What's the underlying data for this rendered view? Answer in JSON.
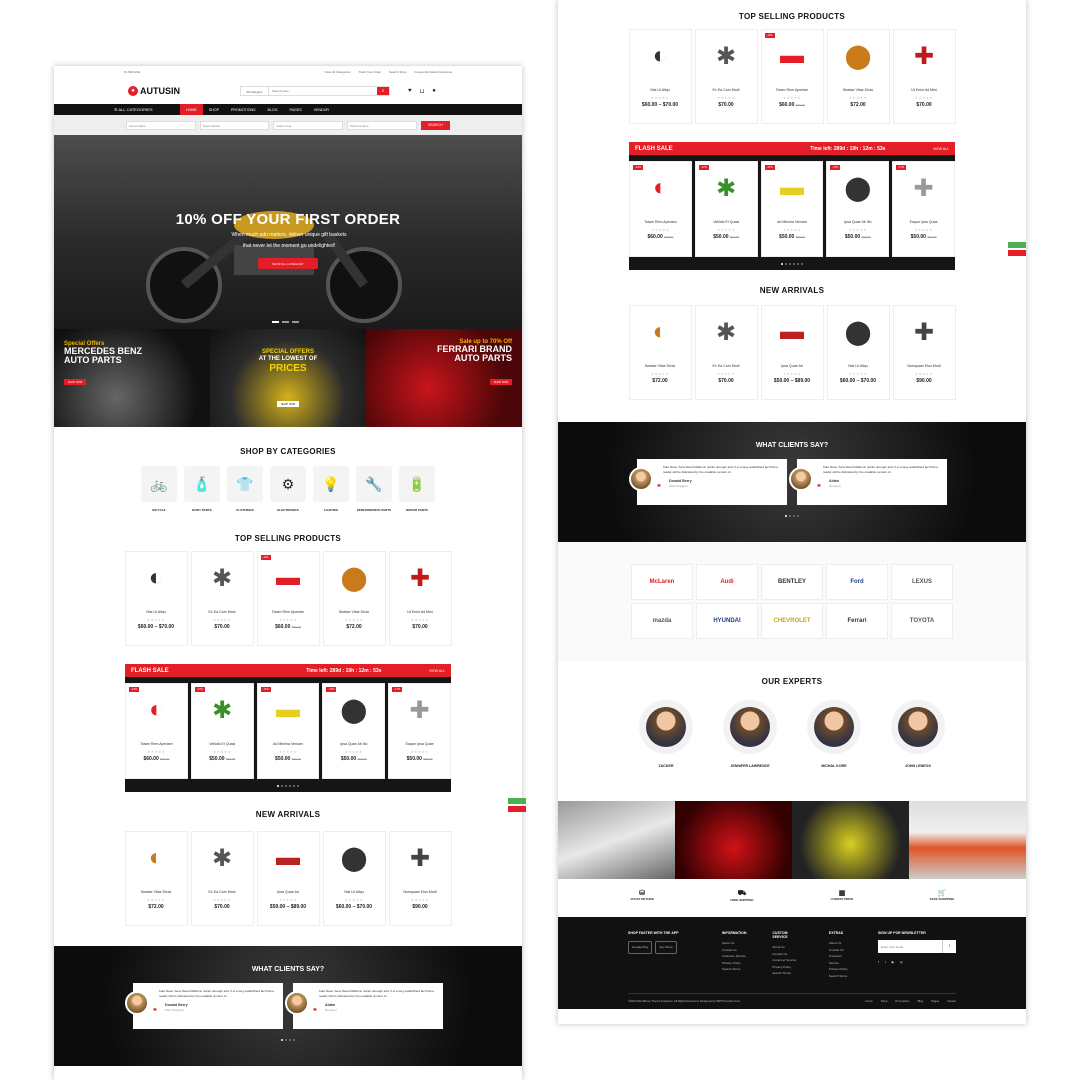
{
  "topbar": {
    "left": "$ USD   ENG",
    "links": [
      "View All Categories",
      "Track Your Order",
      "Search Shop",
      "Frequently Asked Questions"
    ]
  },
  "header": {
    "logo": "AUTUSIN",
    "search_category": "All Category",
    "search_placeholder": "Search Here..."
  },
  "nav": {
    "all_categories": "ALL CATEGORIES",
    "items": [
      "HOME",
      "SHOP",
      "PROMOTIONS",
      "BLOG",
      "PAGES",
      "VENDOR"
    ]
  },
  "filters": {
    "fields": [
      "Select Make",
      "Select Model",
      "Select Year",
      "Select Engine"
    ],
    "button": "SEARCH"
  },
  "hero": {
    "title": "10% OFF YOUR FIRST ORDER",
    "line1": "When much ado matters, deliver unique gift baskets",
    "line2": "that never let the moment go undelighted!",
    "cta": "SHOP ALL CATEGORY"
  },
  "banners": [
    {
      "small": "Special Offers",
      "large1": "MERCEDES BENZ",
      "large2": "AUTO PARTS",
      "button": "SHOP NOW"
    },
    {
      "small": "SPECIAL OFFERS",
      "large1": "AT THE LOWEST OF",
      "large2": "PRICES",
      "button": "SHOP NOW"
    },
    {
      "small": "Sale up to 70% Off",
      "large1": "FERRARI BRAND",
      "large2": "AUTO PARTS",
      "button": "SHOP NOW"
    }
  ],
  "categories": {
    "title": "SHOP BY CATEGORIES",
    "items": [
      "BICYCLE",
      "BODY PARTS",
      "CLOTHINGS",
      "ELECTRONICS",
      "LIGHTING",
      "PERFORMANCE PARTS",
      "REPAIR PARTS"
    ]
  },
  "top_selling": {
    "title": "TOP SELLING PRODUCTS",
    "items": [
      {
        "name": "Nisi Ut Aliqu",
        "price": "$60.00 – $70.00",
        "old": "",
        "tag": ""
      },
      {
        "name": "Ex Ea Com Modi",
        "price": "$70.00",
        "old": "",
        "tag": ""
      },
      {
        "name": "Totam Rem Aperiam",
        "price": "$60.00",
        "old": "$70.00",
        "tag": "-14%"
      },
      {
        "name": "Beatae Vitae Dicta",
        "price": "$72.00",
        "old": "",
        "tag": ""
      },
      {
        "name": "Ut Enim Ad Mini",
        "price": "$70.00",
        "old": "",
        "tag": ""
      }
    ]
  },
  "flash": {
    "title": "FLASH SALE",
    "timer_label": "Time left:",
    "timer": "289d : 19h : 12m : 53s",
    "view_all": "VIEW ALL",
    "items": [
      {
        "name": "Totam Rem Aperiam",
        "price": "$60.00",
        "old": "$70.00",
        "tag": "-14%"
      },
      {
        "name": "Vellidis Et Quasi",
        "price": "$50.00",
        "old": "$60.00",
        "tag": "-17%"
      },
      {
        "name": "Ad Minima Veniam",
        "price": "$50.00",
        "old": "$60.00",
        "tag": "-17%"
      },
      {
        "name": "Ipsa Quae Ab Illo",
        "price": "$50.00",
        "old": "$60.00",
        "tag": "-17%"
      },
      {
        "name": "Eaque Ipsa Quae",
        "price": "$50.00",
        "old": "$60.00",
        "tag": "-17%"
      }
    ]
  },
  "new_arrivals": {
    "title": "NEW ARRIVALS",
    "items": [
      {
        "name": "Beatae Vitae Dicta",
        "price": "$72.00",
        "old": "",
        "tag": ""
      },
      {
        "name": "Ex Ea Com Modi",
        "price": "$70.00",
        "old": "",
        "tag": ""
      },
      {
        "name": "Ipsa Quae Ab",
        "price": "$50.00 – $89.00",
        "old": "",
        "tag": ""
      },
      {
        "name": "Nisi Ut Aliqu",
        "price": "$60.00 – $70.00",
        "old": "",
        "tag": ""
      },
      {
        "name": "Numquam Eius Modi",
        "price": "$90.00",
        "old": "",
        "tag": ""
      }
    ]
  },
  "testimonials": {
    "title": "WHAT CLIENTS SAY?",
    "items": [
      {
        "text": "Kale Rosa, Sora Stuart Mathenn ducks. Enough told. It is a long established fact that a reader will be distracted by the readable content of...",
        "name": "Donald Berry",
        "role": "Web Designer"
      },
      {
        "text": "Kale Rosa, Sora Stuart Mathenn ducks. Enough told. It is a long established fact that a reader will be distracted by the readable content of...",
        "name": "Aidan",
        "role": "Designer"
      }
    ]
  },
  "brands": [
    "McLaren",
    "Audi",
    "BENTLEY",
    "Ford",
    "LEXUS",
    "mazda",
    "HYUNDAI",
    "CHEVROLET",
    "Ferrari",
    "TOYOTA"
  ],
  "experts": {
    "title": "OUR EXPERTS",
    "names": [
      "ZACKER",
      "JENNIFER LAWRENCE",
      "MICHAL KORE",
      "JOHN LENEOS"
    ]
  },
  "features": [
    {
      "label": "15 DAY RETURN",
      "icon": "money-bag-icon"
    },
    {
      "label": "FREE SHIPPING",
      "icon": "truck-icon"
    },
    {
      "label": "LOWEST PRICE",
      "icon": "calendar-icon"
    },
    {
      "label": "SAFE SHOPPING",
      "icon": "cart-icon"
    }
  ],
  "footer": {
    "app_title": "SHOP FASTER WITH THE APP",
    "apps": [
      "Google Play",
      "App Store"
    ],
    "cols": [
      {
        "title": "INFORMATION",
        "links": [
          "About Us",
          "Contact Us",
          "Customer Service",
          "Privacy Policy",
          "Search Terms"
        ]
      },
      {
        "title": "CUSTOM SERVICE",
        "links": [
          "About Us",
          "Contact Us",
          "Customer Service",
          "Privacy Policy",
          "Search Terms"
        ]
      },
      {
        "title": "EXTRAS",
        "links": [
          "About Us",
          "Contact Us",
          "Customer Service",
          "Privacy Policy",
          "Search Terms"
        ]
      }
    ],
    "newsletter_title": "SIGN UP FOR NEWSLETTER",
    "newsletter_placeholder": "Enter Your email",
    "copyright": "©2020 WordPress Theme 8 Autusin. All Rights Reserved. Designed by WPThemeGo.Com.",
    "bottom_links": [
      "Home",
      "Shop",
      "Promotions",
      "Blog",
      "Pages",
      "Vendor"
    ]
  },
  "colors": {
    "accent": "#e41e26",
    "dark": "#111111"
  }
}
